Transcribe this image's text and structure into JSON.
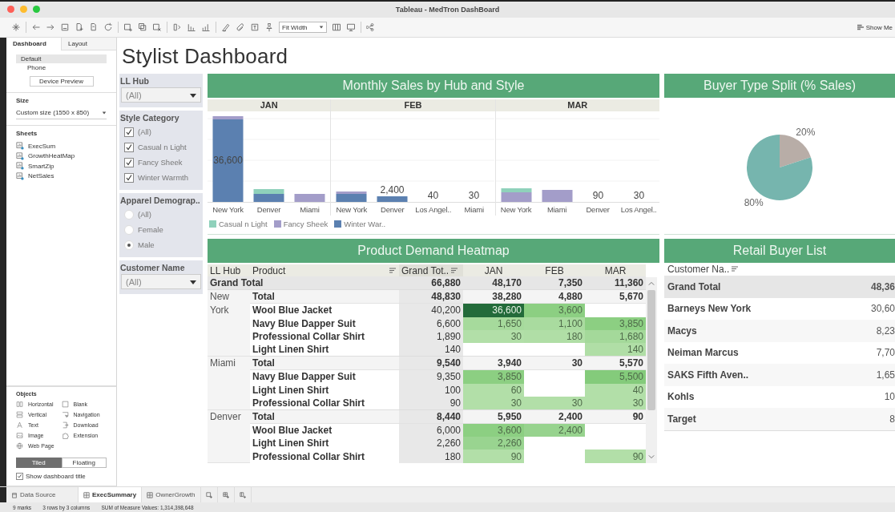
{
  "window": {
    "title": "Tableau - MedTron DashBoard"
  },
  "toolbar": {
    "fit": "Fit Width",
    "show_me": "Show Me"
  },
  "sidebar": {
    "tabs": [
      {
        "label": "Dashboard",
        "selected": true
      },
      {
        "label": "Layout",
        "selected": false
      }
    ],
    "devices": [
      {
        "label": "Default",
        "selected": true
      },
      {
        "label": "Phone",
        "selected": false
      }
    ],
    "device_preview": "Device Preview",
    "size": {
      "heading": "Size",
      "value": "Custom size (1550 x 850)"
    },
    "sheets": {
      "heading": "Sheets",
      "items": [
        "ExecSum",
        "GrowthHeatMap",
        "SmartZip",
        "NetSales"
      ]
    },
    "objects": {
      "heading": "Objects",
      "items": [
        {
          "label": "Horizontal",
          "kind": "horizontal"
        },
        {
          "label": "Blank",
          "kind": "blank"
        },
        {
          "label": "Vertical",
          "kind": "vertical"
        },
        {
          "label": "Navigation",
          "kind": "navigation"
        },
        {
          "label": "Text",
          "kind": "text"
        },
        {
          "label": "Download",
          "kind": "download"
        },
        {
          "label": "Image",
          "kind": "image"
        },
        {
          "label": "Extension",
          "kind": "extension"
        },
        {
          "label": "Web Page",
          "kind": "webpage"
        }
      ]
    },
    "layout_modes": [
      {
        "label": "Tiled",
        "selected": true
      },
      {
        "label": "Floating",
        "selected": false
      }
    ],
    "show_title": {
      "label": "Show dashboard title",
      "checked": true
    }
  },
  "dashboard": {
    "title": "Stylist Dashboard",
    "filters": [
      {
        "kind": "dropdown",
        "title": "LL Hub",
        "value": "(All)"
      },
      {
        "kind": "checklist",
        "title": "Style Category",
        "options": [
          {
            "label": "(All)",
            "checked": true
          },
          {
            "label": "Casual n Light",
            "checked": true
          },
          {
            "label": "Fancy Sheek",
            "checked": true
          },
          {
            "label": "Winter Warmth",
            "checked": true
          }
        ]
      },
      {
        "kind": "radio",
        "title": "Apparel Demograp..",
        "options": [
          {
            "label": "(All)",
            "selected": false
          },
          {
            "label": "Female",
            "selected": false
          },
          {
            "label": "Male",
            "selected": true
          }
        ]
      },
      {
        "kind": "dropdown",
        "title": "Customer Name",
        "value": "(All)"
      }
    ],
    "monthly_sales": {
      "title": "Monthly Sales by Hub and Style",
      "panes": [
        {
          "label": "JAN",
          "bars": [
            {
              "category": "New York",
              "value_label": "36,600"
            },
            {
              "category": "Denver"
            },
            {
              "category": "Miami"
            }
          ]
        },
        {
          "label": "FEB",
          "bars": [
            {
              "category": "New York"
            },
            {
              "category": "Denver",
              "value_label": "2,400"
            },
            {
              "category": "Los Angel..",
              "value_label": "40"
            },
            {
              "category": "Miami",
              "value_label": "30"
            }
          ]
        },
        {
          "label": "MAR",
          "bars": [
            {
              "category": "New York"
            },
            {
              "category": "Miami"
            },
            {
              "category": "Denver",
              "value_label": "90"
            },
            {
              "category": "Los Angel..",
              "value_label": "30"
            }
          ]
        }
      ],
      "legend": [
        {
          "label": "Casual n Light",
          "color": "#8fd1bb"
        },
        {
          "label": "Fancy Sheek",
          "color": "#a39dc9"
        },
        {
          "label": "Winter War..",
          "color": "#5b80b0"
        }
      ]
    },
    "buyer_split": {
      "title": "Buyer Type Split (% Sales)",
      "chart_data": {
        "type": "pie",
        "values": [
          20,
          80
        ],
        "colors": [
          "#b8ada7",
          "#76b5ae"
        ],
        "value_labels": [
          "20%",
          "80%"
        ]
      }
    },
    "heatmap": {
      "title": "Product Demand Heatmap",
      "columns": [
        {
          "label": "LL Hub",
          "sortable": false
        },
        {
          "label": "Product",
          "sortable": true
        },
        {
          "label": "Grand Tot..",
          "sortable": true
        },
        {
          "label": "JAN",
          "sortable": false
        },
        {
          "label": "FEB",
          "sortable": false
        },
        {
          "label": "MAR",
          "sortable": false
        }
      ],
      "grand_total": {
        "label": "Grand Total",
        "grand": "66,880",
        "months": [
          "48,170",
          "7,350",
          "11,360"
        ]
      },
      "groups": [
        {
          "hub": "New York",
          "rows": [
            {
              "kind": "total",
              "product": "Total",
              "grand": "48,830",
              "months": {
                "jan": {
                  "value": "38,280"
                },
                "feb": {
                  "value": "4,880"
                },
                "mar": {
                  "value": "5,670"
                }
              }
            },
            {
              "kind": "item",
              "product": "Wool Blue Jacket",
              "grand": "40,200",
              "months": {
                "jan": {
                  "value": "36,600",
                  "color": "#236b3a"
                },
                "feb": {
                  "value": "3,600",
                  "color": "#8ccf82"
                }
              }
            },
            {
              "kind": "item",
              "product": "Navy Blue Dapper Suit",
              "grand": "6,600",
              "months": {
                "jan": {
                  "value": "1,650",
                  "color": "#a6da9c"
                },
                "feb": {
                  "value": "1,100",
                  "color": "#a9db9f"
                },
                "mar": {
                  "value": "3,850",
                  "color": "#8ccf82"
                }
              }
            },
            {
              "kind": "item",
              "product": "Professional Collar Shirt",
              "grand": "1,890",
              "months": {
                "jan": {
                  "value": "30",
                  "color": "#b2dfa8"
                },
                "feb": {
                  "value": "180",
                  "color": "#b0dea6"
                },
                "mar": {
                  "value": "1,680",
                  "color": "#a4d99a"
                }
              }
            },
            {
              "kind": "item",
              "product": "Light Linen Shirt",
              "grand": "140",
              "months": {
                "mar": {
                  "value": "140",
                  "color": "#b0dea6"
                }
              }
            }
          ]
        },
        {
          "hub": "Miami",
          "rows": [
            {
              "kind": "total",
              "product": "Total",
              "grand": "9,540",
              "months": {
                "jan": {
                  "value": "3,940"
                },
                "feb": {
                  "value": "30"
                },
                "mar": {
                  "value": "5,570"
                }
              }
            },
            {
              "kind": "item",
              "product": "Navy Blue Dapper Suit",
              "grand": "9,350",
              "months": {
                "jan": {
                  "value": "3,850",
                  "color": "#8ccf82"
                },
                "mar": {
                  "value": "5,500",
                  "color": "#84cb7b"
                }
              }
            },
            {
              "kind": "item",
              "product": "Light Linen Shirt",
              "grand": "100",
              "months": {
                "jan": {
                  "value": "60",
                  "color": "#b2dfa8"
                },
                "mar": {
                  "value": "40",
                  "color": "#b2dfa8"
                }
              }
            },
            {
              "kind": "item",
              "product": "Professional Collar Shirt",
              "grand": "90",
              "months": {
                "jan": {
                  "value": "30",
                  "color": "#b2dfa8"
                },
                "feb": {
                  "value": "30",
                  "color": "#b2dfa8"
                },
                "mar": {
                  "value": "30",
                  "color": "#b2dfa8"
                }
              }
            }
          ]
        },
        {
          "hub": "Denver",
          "rows": [
            {
              "kind": "total",
              "product": "Total",
              "grand": "8,440",
              "months": {
                "jan": {
                  "value": "5,950"
                },
                "feb": {
                  "value": "2,400"
                },
                "mar": {
                  "value": "90"
                }
              }
            },
            {
              "kind": "item",
              "product": "Wool Blue Jacket",
              "grand": "6,000",
              "months": {
                "jan": {
                  "value": "3,600",
                  "color": "#8ccf82"
                },
                "feb": {
                  "value": "2,400",
                  "color": "#97d38e"
                }
              }
            },
            {
              "kind": "item",
              "product": "Light Linen Shirt",
              "grand": "2,260",
              "months": {
                "jan": {
                  "value": "2,260",
                  "color": "#99d490"
                }
              }
            },
            {
              "kind": "item",
              "product": "Professional Collar Shirt",
              "grand": "180",
              "months": {
                "jan": {
                  "value": "90",
                  "color": "#b2dfa8"
                },
                "mar": {
                  "value": "90",
                  "color": "#b2dfa8"
                }
              }
            }
          ]
        }
      ]
    },
    "buyer_list": {
      "title": "Retail Buyer List",
      "header": "Customer Na..",
      "rows": [
        {
          "kind": "total",
          "name": "Grand Total",
          "value": "48,36"
        },
        {
          "kind": "item",
          "name": "Barneys New York",
          "value": "30,60"
        },
        {
          "kind": "item",
          "name": "Macys",
          "value": "8,23"
        },
        {
          "kind": "item",
          "name": "Neiman Marcus",
          "value": "7,70"
        },
        {
          "kind": "item",
          "name": "SAKS Fifth Aven..",
          "value": "1,65"
        },
        {
          "kind": "item",
          "name": "Kohls",
          "value": "10"
        },
        {
          "kind": "item",
          "name": "Target",
          "value": "8"
        }
      ]
    }
  },
  "sheet_tabs": [
    {
      "label": "Data Source",
      "kind": "datasource",
      "selected": false
    },
    {
      "label": "ExecSummary",
      "kind": "sheet",
      "selected": true
    },
    {
      "label": "OwnerGrowth",
      "kind": "sheet",
      "selected": false
    }
  ],
  "status_bar": [
    "9 marks",
    "3 rows by 3 columns",
    "SUM of Measure Values: 1,314,398,648"
  ]
}
